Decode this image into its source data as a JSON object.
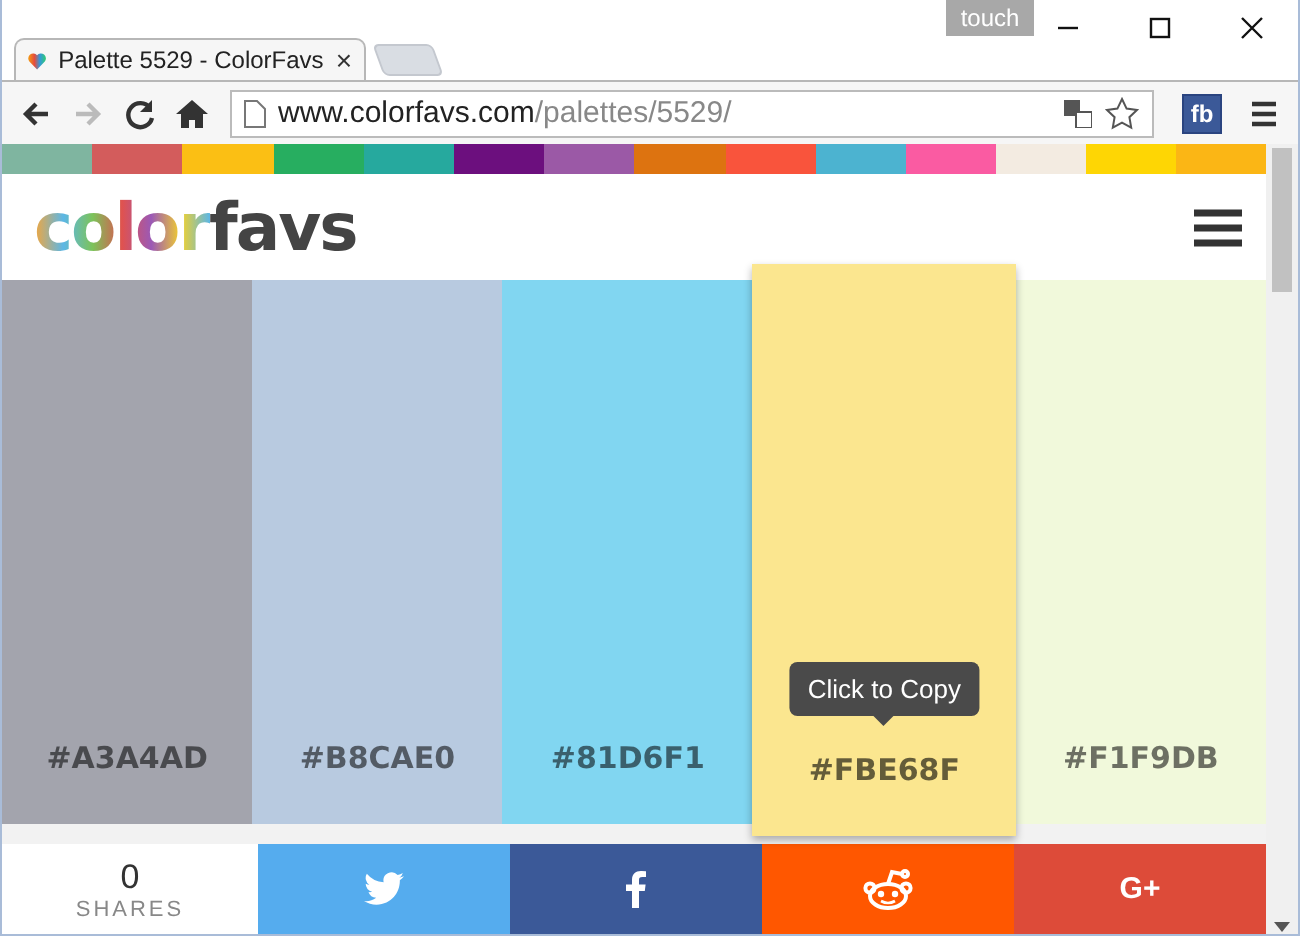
{
  "window": {
    "badge": "touch"
  },
  "tab": {
    "title": "Palette 5529 - ColorFavs",
    "close": "×"
  },
  "address": {
    "host": "www.colorfavs.com",
    "path": "/palettes/5529/"
  },
  "extension": {
    "label": "fb"
  },
  "strip": [
    {
      "color": "#7fb5a0"
    },
    {
      "color": "#d35c5c"
    },
    {
      "color": "#fbbf14"
    },
    {
      "color": "#27ae60"
    },
    {
      "color": "#26a99e"
    },
    {
      "color": "#6c0f7e"
    },
    {
      "color": "#9b59a6"
    },
    {
      "color": "#dd7310"
    },
    {
      "color": "#f9543c"
    },
    {
      "color": "#4cb3d0"
    },
    {
      "color": "#fa5ba2"
    },
    {
      "color": "#f3ebe1"
    },
    {
      "color": "#fed604"
    },
    {
      "color": "#fbb615"
    }
  ],
  "logo": {
    "parts": [
      "color",
      "favs"
    ]
  },
  "swatches": [
    {
      "hex": "#A3A4AD",
      "color": "#a3a4ad",
      "selected": false
    },
    {
      "hex": "#B8CAE0",
      "color": "#b8cae0",
      "selected": false
    },
    {
      "hex": "#81D6F1",
      "color": "#81d6f1",
      "selected": false
    },
    {
      "hex": "#FBE68F",
      "color": "#fbe68f",
      "selected": true
    },
    {
      "hex": "#F1F9DB",
      "color": "#f1f9db",
      "selected": false
    }
  ],
  "tooltip": "Click to Copy",
  "shares": {
    "count": "0",
    "label": "SHARES"
  },
  "share_buttons": [
    {
      "kind": "twitter"
    },
    {
      "kind": "facebook"
    },
    {
      "kind": "reddit"
    },
    {
      "kind": "googleplus",
      "label": "G+"
    }
  ]
}
